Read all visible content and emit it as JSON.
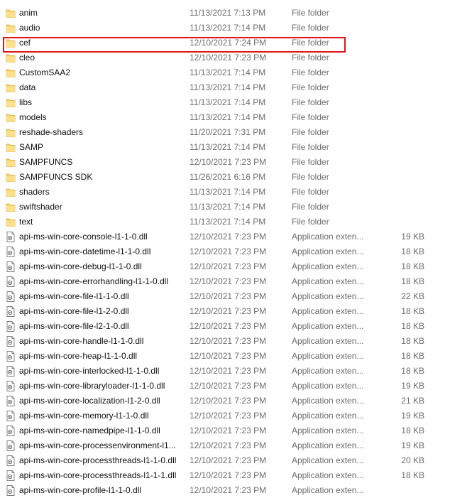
{
  "highlight_color": "#e0161b",
  "files": [
    {
      "name": "anim",
      "date": "11/13/2021 7:13 PM",
      "type": "File folder",
      "size": "",
      "icon": "folder-icon"
    },
    {
      "name": "audio",
      "date": "11/13/2021 7:14 PM",
      "type": "File folder",
      "size": "",
      "icon": "folder-icon"
    },
    {
      "name": "cef",
      "date": "12/10/2021 7:24 PM",
      "type": "File folder",
      "size": "",
      "icon": "folder-icon"
    },
    {
      "name": "cleo",
      "date": "12/10/2021 7:23 PM",
      "type": "File folder",
      "size": "",
      "icon": "folder-icon"
    },
    {
      "name": "CustomSAA2",
      "date": "11/13/2021 7:14 PM",
      "type": "File folder",
      "size": "",
      "icon": "folder-icon"
    },
    {
      "name": "data",
      "date": "11/13/2021 7:14 PM",
      "type": "File folder",
      "size": "",
      "icon": "folder-icon"
    },
    {
      "name": "libs",
      "date": "11/13/2021 7:14 PM",
      "type": "File folder",
      "size": "",
      "icon": "folder-icon"
    },
    {
      "name": "models",
      "date": "11/13/2021 7:14 PM",
      "type": "File folder",
      "size": "",
      "icon": "folder-icon"
    },
    {
      "name": "reshade-shaders",
      "date": "11/20/2021 7:31 PM",
      "type": "File folder",
      "size": "",
      "icon": "folder-icon"
    },
    {
      "name": "SAMP",
      "date": "11/13/2021 7:14 PM",
      "type": "File folder",
      "size": "",
      "icon": "folder-icon"
    },
    {
      "name": "SAMPFUNCS",
      "date": "12/10/2021 7:23 PM",
      "type": "File folder",
      "size": "",
      "icon": "folder-icon"
    },
    {
      "name": "SAMPFUNCS SDK",
      "date": "11/26/2021 6:16 PM",
      "type": "File folder",
      "size": "",
      "icon": "folder-icon"
    },
    {
      "name": "shaders",
      "date": "11/13/2021 7:14 PM",
      "type": "File folder",
      "size": "",
      "icon": "folder-icon"
    },
    {
      "name": "swiftshader",
      "date": "11/13/2021 7:14 PM",
      "type": "File folder",
      "size": "",
      "icon": "folder-icon"
    },
    {
      "name": "text",
      "date": "11/13/2021 7:14 PM",
      "type": "File folder",
      "size": "",
      "icon": "folder-icon"
    },
    {
      "name": "api-ms-win-core-console-l1-1-0.dll",
      "date": "12/10/2021 7:23 PM",
      "type": "Application exten...",
      "size": "19 KB",
      "icon": "dll-file-icon"
    },
    {
      "name": "api-ms-win-core-datetime-l1-1-0.dll",
      "date": "12/10/2021 7:23 PM",
      "type": "Application exten...",
      "size": "18 KB",
      "icon": "dll-file-icon"
    },
    {
      "name": "api-ms-win-core-debug-l1-1-0.dll",
      "date": "12/10/2021 7:23 PM",
      "type": "Application exten...",
      "size": "18 KB",
      "icon": "dll-file-icon"
    },
    {
      "name": "api-ms-win-core-errorhandling-l1-1-0.dll",
      "date": "12/10/2021 7:23 PM",
      "type": "Application exten...",
      "size": "18 KB",
      "icon": "dll-file-icon"
    },
    {
      "name": "api-ms-win-core-file-l1-1-0.dll",
      "date": "12/10/2021 7:23 PM",
      "type": "Application exten...",
      "size": "22 KB",
      "icon": "dll-file-icon"
    },
    {
      "name": "api-ms-win-core-file-l1-2-0.dll",
      "date": "12/10/2021 7:23 PM",
      "type": "Application exten...",
      "size": "18 KB",
      "icon": "dll-file-icon"
    },
    {
      "name": "api-ms-win-core-file-l2-1-0.dll",
      "date": "12/10/2021 7:23 PM",
      "type": "Application exten...",
      "size": "18 KB",
      "icon": "dll-file-icon"
    },
    {
      "name": "api-ms-win-core-handle-l1-1-0.dll",
      "date": "12/10/2021 7:23 PM",
      "type": "Application exten...",
      "size": "18 KB",
      "icon": "dll-file-icon"
    },
    {
      "name": "api-ms-win-core-heap-l1-1-0.dll",
      "date": "12/10/2021 7:23 PM",
      "type": "Application exten...",
      "size": "18 KB",
      "icon": "dll-file-icon"
    },
    {
      "name": "api-ms-win-core-interlocked-l1-1-0.dll",
      "date": "12/10/2021 7:23 PM",
      "type": "Application exten...",
      "size": "18 KB",
      "icon": "dll-file-icon"
    },
    {
      "name": "api-ms-win-core-libraryloader-l1-1-0.dll",
      "date": "12/10/2021 7:23 PM",
      "type": "Application exten...",
      "size": "19 KB",
      "icon": "dll-file-icon"
    },
    {
      "name": "api-ms-win-core-localization-l1-2-0.dll",
      "date": "12/10/2021 7:23 PM",
      "type": "Application exten...",
      "size": "21 KB",
      "icon": "dll-file-icon"
    },
    {
      "name": "api-ms-win-core-memory-l1-1-0.dll",
      "date": "12/10/2021 7:23 PM",
      "type": "Application exten...",
      "size": "19 KB",
      "icon": "dll-file-icon"
    },
    {
      "name": "api-ms-win-core-namedpipe-l1-1-0.dll",
      "date": "12/10/2021 7:23 PM",
      "type": "Application exten...",
      "size": "18 KB",
      "icon": "dll-file-icon"
    },
    {
      "name": "api-ms-win-core-processenvironment-l1...",
      "date": "12/10/2021 7:23 PM",
      "type": "Application exten...",
      "size": "19 KB",
      "icon": "dll-file-icon"
    },
    {
      "name": "api-ms-win-core-processthreads-l1-1-0.dll",
      "date": "12/10/2021 7:23 PM",
      "type": "Application exten...",
      "size": "20 KB",
      "icon": "dll-file-icon"
    },
    {
      "name": "api-ms-win-core-processthreads-l1-1-1.dll",
      "date": "12/10/2021 7:23 PM",
      "type": "Application exten...",
      "size": "18 KB",
      "icon": "dll-file-icon"
    },
    {
      "name": "api-ms-win-core-profile-l1-1-0.dll",
      "date": "12/10/2021 7:23 PM",
      "type": "Application exten...",
      "size": "",
      "icon": "dll-file-icon"
    }
  ]
}
